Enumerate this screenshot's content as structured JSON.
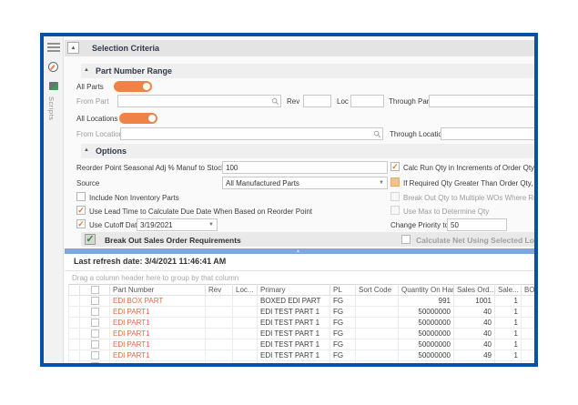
{
  "icons": {
    "collapse": "▲",
    "dropdown": "▼",
    "grip": "▲",
    "check": "✓"
  },
  "sidebar": {
    "scripts_label": "Scripts"
  },
  "header": {
    "title": "Selection Criteria"
  },
  "part_number_range": {
    "title": "Part Number Range",
    "all_parts": "All Parts",
    "from_part": "From Part",
    "rev": "Rev",
    "loc": "Loc",
    "through_part": "Through Part",
    "all_locations": "All Locations",
    "from_location": "From Location",
    "through_location": "Through Location"
  },
  "options": {
    "title": "Options",
    "reorder_label": "Reorder Point Seasonal Adj % Manuf to Stock Parts",
    "reorder_value": "100",
    "source_label": "Source",
    "source_value": "All Manufactured Parts",
    "include_non_inventory": "Include Non Inventory Parts",
    "use_lead_time": "Use Lead Time to Calculate Due Date When Based on Reorder Point",
    "use_cutoff_date": "Use Cutoff Date",
    "cutoff_date_value": "3/19/2021",
    "calc_run_qty": "Calc Run Qty in Increments of Order Qty",
    "if_required": "If Required Qty Greater Than Order Qty, Use Requ",
    "break_out_qty": "Break Out Qty to Multiple WOs Where Run Qty Equ",
    "use_max": "Use Max to Determine Qty",
    "change_priority_label": "Change Priority to",
    "change_priority_value": "50",
    "break_out_sales": "Break Out Sales Order Requirements",
    "calculate_net": "Calculate Net Using Selected Locations - M"
  },
  "status": {
    "last_refresh": "Last refresh date: 3/4/2021 11:46:41 AM"
  },
  "grid": {
    "group_hint": "Drag a column header here to group by that column",
    "columns": [
      "Part Number",
      "Rev",
      "Loc...",
      "Primary",
      "PL",
      "Sort Code",
      "Quantity On Hand",
      "Sales Ord...",
      "Sale...",
      "BOM"
    ],
    "rows": [
      {
        "part_number": "EDI BOX PART",
        "rev": "",
        "loc": "",
        "primary": "BOXED EDI PART",
        "pl": "FG",
        "sort_code": "",
        "quantity_on_hand": "991",
        "sales_ord": "1001",
        "sale": "1",
        "bom": ""
      },
      {
        "part_number": "EDI PART1",
        "rev": "",
        "loc": "",
        "primary": "EDI TEST PART 1",
        "pl": "FG",
        "sort_code": "",
        "quantity_on_hand": "50000000",
        "sales_ord": "40",
        "sale": "1",
        "bom": ""
      },
      {
        "part_number": "EDI PART1",
        "rev": "",
        "loc": "",
        "primary": "EDI TEST PART 1",
        "pl": "FG",
        "sort_code": "",
        "quantity_on_hand": "50000000",
        "sales_ord": "40",
        "sale": "1",
        "bom": ""
      },
      {
        "part_number": "EDI PART1",
        "rev": "",
        "loc": "",
        "primary": "EDI TEST PART 1",
        "pl": "FG",
        "sort_code": "",
        "quantity_on_hand": "50000000",
        "sales_ord": "40",
        "sale": "1",
        "bom": ""
      },
      {
        "part_number": "EDI PART1",
        "rev": "",
        "loc": "",
        "primary": "EDI TEST PART 1",
        "pl": "FG",
        "sort_code": "",
        "quantity_on_hand": "50000000",
        "sales_ord": "40",
        "sale": "1",
        "bom": ""
      },
      {
        "part_number": "EDI PART1",
        "rev": "",
        "loc": "",
        "primary": "EDI TEST PART 1",
        "pl": "FG",
        "sort_code": "",
        "quantity_on_hand": "50000000",
        "sales_ord": "49",
        "sale": "1",
        "bom": ""
      }
    ]
  },
  "colors": {
    "frame_blue": "#0b4fa6",
    "splitter_blue": "#7ea8dd",
    "accent_orange": "#ef8347",
    "indeterminate_orange": "#f5c08f",
    "link_orange": "#dd6b45",
    "check_green": "#2e8b2e"
  }
}
